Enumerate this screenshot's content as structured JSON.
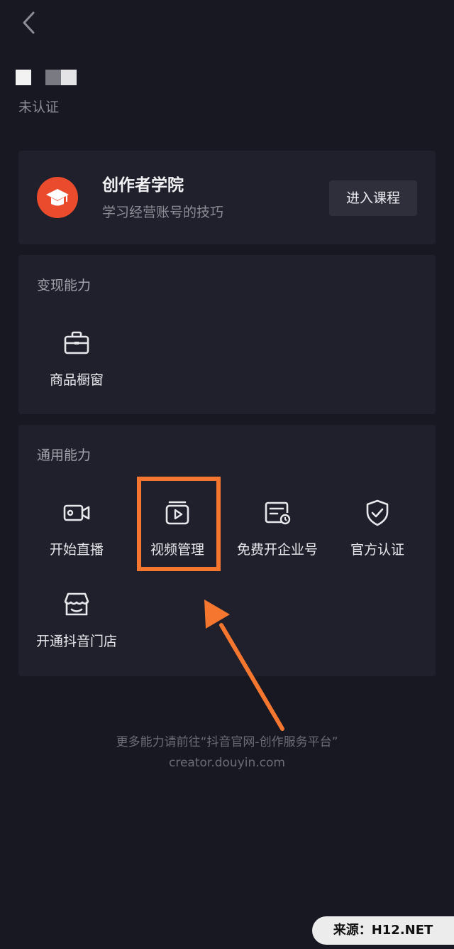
{
  "header": {
    "back_icon": "chevron-left-icon"
  },
  "profile": {
    "verify_status": "未认证"
  },
  "academy": {
    "title": "创作者学院",
    "subtitle": "学习经营账号的技巧",
    "button_label": "进入课程",
    "logo_icon": "graduation-cap-icon",
    "logo_color": "#ea4b2c"
  },
  "monetize": {
    "title": "变现能力",
    "items": [
      {
        "label": "商品橱窗",
        "icon": "briefcase-icon"
      }
    ]
  },
  "general": {
    "title": "通用能力",
    "items": [
      {
        "label": "开始直播",
        "icon": "video-camera-icon"
      },
      {
        "label": "视频管理",
        "icon": "video-folder-icon"
      },
      {
        "label": "免费开企业号",
        "icon": "enterprise-card-icon"
      },
      {
        "label": "官方认证",
        "icon": "shield-check-icon"
      },
      {
        "label": "开通抖音门店",
        "icon": "storefront-icon"
      }
    ]
  },
  "footer": {
    "hint": "更多能力请前往“抖音官网-创作服务平台”",
    "url": "creator.douyin.com"
  },
  "watermark": {
    "text": "来源：H12.NET"
  },
  "annotation": {
    "color": "#f5772f"
  },
  "colors": {
    "background": "#171822",
    "card": "#1f202b",
    "button": "#2e2f3b"
  }
}
